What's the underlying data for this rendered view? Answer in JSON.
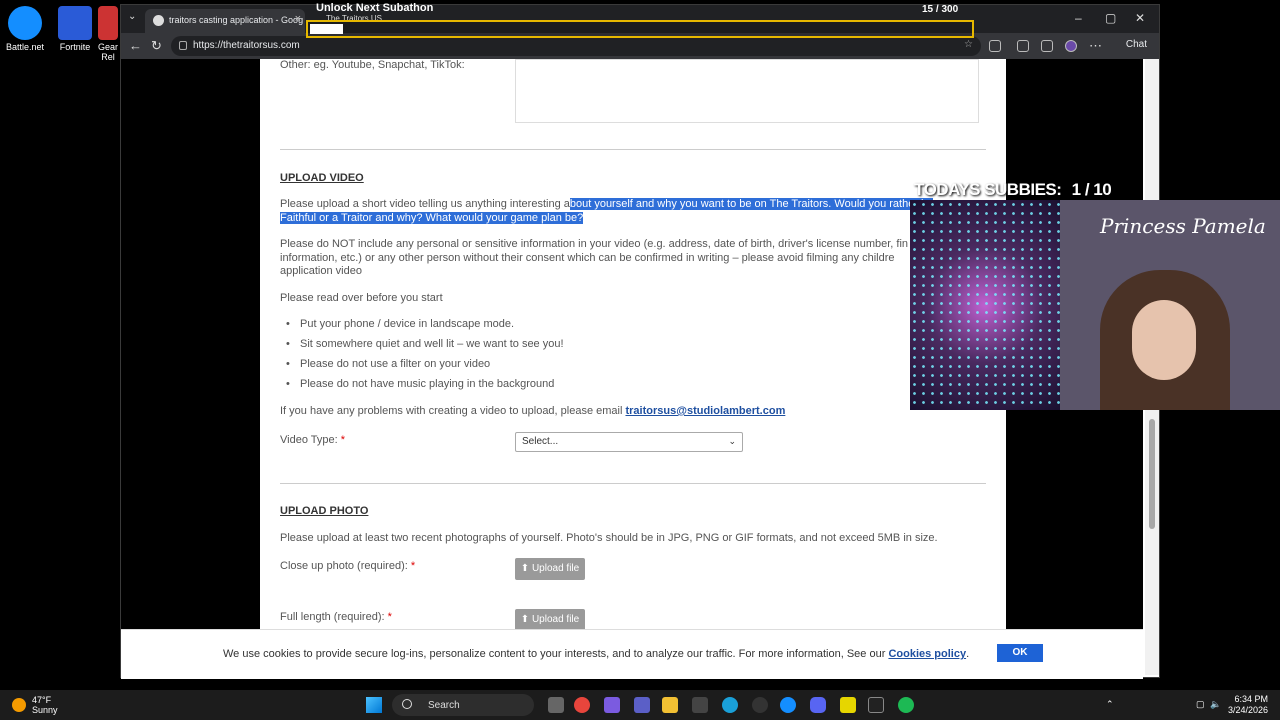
{
  "desktop": {
    "icons": [
      {
        "label": "Battle.net",
        "color": "#148eff"
      },
      {
        "label": "Fortnite",
        "color": "#2a5bd7"
      },
      {
        "label": "Gear Rel",
        "color": "#c33"
      }
    ]
  },
  "browser": {
    "tab_title": "traitors casting application - Goog",
    "url": "https://thetraitorsus.com",
    "chat_label": "Chat"
  },
  "overlay": {
    "title": "Unlock Next Subathon",
    "subtitle": "The Traitors US",
    "count": "15 / 300",
    "progress": 0.05,
    "subbies_label": "TODAYS SUBBIES:",
    "subbies_count": "1 / 10",
    "streamer_name": "Princess Pamela"
  },
  "page": {
    "social_label": "Other: eg. Youtube, Snapchat, TikTok:",
    "upload_video_heading": "UPLOAD VIDEO",
    "video_intro_plain": "Please upload a short video telling us anything interesting a",
    "video_intro_highlight_1": "bout yourself and why you want to be on The Traitors. Would you rather be",
    "video_intro_highlight_2": "Faithful or a Traitor and why? What would your game plan be?",
    "privacy_line_1": "Please do NOT include any personal or sensitive information in your video (e.g. address, date of birth, driver's license number, fin",
    "privacy_line_2": "information, etc.) or any other person without their consent which can be confirmed in writing – please avoid filming any childre",
    "privacy_line_3": "application video",
    "read_over": "Please read over before you start",
    "tips": [
      "Put your phone / device in landscape mode.",
      "Sit somewhere quiet and well lit – we want to see you!",
      "Please do not use a filter on your video",
      "Please do not have music playing in the background"
    ],
    "problems_text": "If you have any problems with creating a video to upload, please email ",
    "problems_email": "traitorsus@studiolambert.com",
    "video_type_label": "Video Type: ",
    "required_mark": "*",
    "video_type_value": "Select...",
    "upload_photo_heading": "UPLOAD PHOTO",
    "photo_instructions": "Please upload at least two recent photographs of yourself. Photo's should be in JPG, PNG or GIF formats, and not exceed 5MB in size.",
    "closeup_label": "Close up photo (required): ",
    "fulllength_label": "Full length (required): ",
    "upload_button": "Upload file"
  },
  "cookie": {
    "text": "We use cookies to provide secure log-ins, personalize content to your interests, and to analyze our traffic. For more information, See our ",
    "link": "Cookies policy",
    "after": ".",
    "ok": "OK"
  },
  "taskbar": {
    "temp": "47°F",
    "weather": "Sunny",
    "search": "Search",
    "time": "6:34 PM",
    "date": "3/24/2026"
  }
}
